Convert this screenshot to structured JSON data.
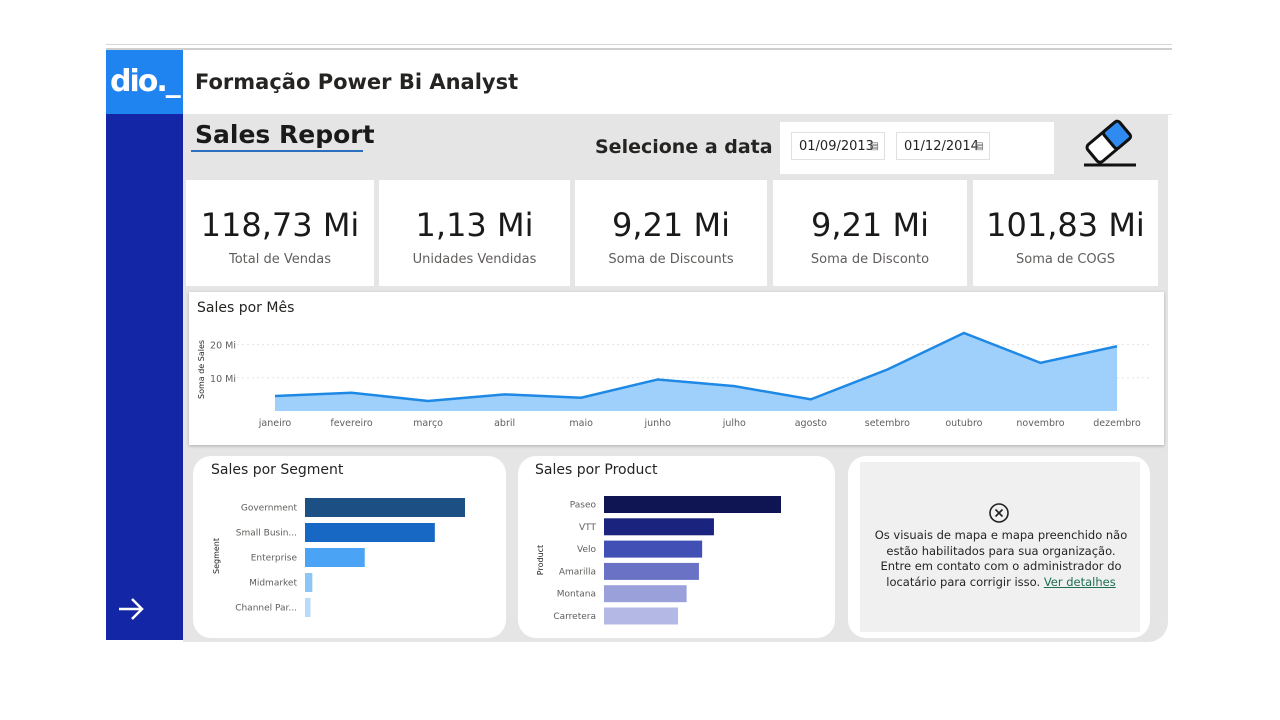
{
  "app": {
    "logo_text": "dio._",
    "title": "Formação Power Bi Analyst"
  },
  "report": {
    "title": "Sales Report",
    "date_label": "Selecione a data",
    "date_start": "01/09/2013",
    "date_end": "01/12/2014"
  },
  "kpis": [
    {
      "value": "118,73 Mi",
      "label": "Total de Vendas"
    },
    {
      "value": "1,13 Mi",
      "label": "Unidades Vendidas"
    },
    {
      "value": "9,21 Mi",
      "label": "Soma de Discounts"
    },
    {
      "value": "9,21 Mi",
      "label": "Soma de Disconto"
    },
    {
      "value": "101,83 Mi",
      "label": "Soma de COGS"
    }
  ],
  "chart_data": [
    {
      "type": "area",
      "title": "Sales por Mês",
      "ylabel": "Soma de Sales",
      "xlabel": "",
      "yticks": [
        "10 Mi",
        "20 Mi"
      ],
      "ylim": [
        0,
        25
      ],
      "grid": true,
      "categories": [
        "janeiro",
        "fevereiro",
        "março",
        "abril",
        "maio",
        "junho",
        "julho",
        "agosto",
        "setembro",
        "outubro",
        "novembro",
        "dezembro"
      ],
      "values": [
        4.5,
        5.5,
        3.0,
        5.0,
        4.0,
        9.5,
        7.5,
        3.5,
        12.5,
        23.5,
        14.5,
        19.5
      ]
    },
    {
      "type": "bar",
      "orientation": "horizontal",
      "title": "Sales por Segment",
      "ylabel": "Segment",
      "categories": [
        "Government",
        "Small Busin...",
        "Enterprise",
        "Midmarket",
        "Channel Par..."
      ],
      "values": [
        52.5,
        42.6,
        19.6,
        2.4,
        1.8
      ],
      "colors": [
        "#1c4f84",
        "#1668c4",
        "#4aa3f5",
        "#8cc6f7",
        "#b7dbfa"
      ]
    },
    {
      "type": "bar",
      "orientation": "horizontal",
      "title": "Sales por Product",
      "ylabel": "Product",
      "categories": [
        "Paseo",
        "VTT",
        "Velo",
        "Amarilla",
        "Montana",
        "Carretera"
      ],
      "values": [
        33.0,
        20.5,
        18.3,
        17.7,
        15.4,
        13.8
      ],
      "colors": [
        "#0f1553",
        "#1a237e",
        "#4050b5",
        "#6a72c6",
        "#9aa1da",
        "#b3b8e4"
      ]
    }
  ],
  "map_visual": {
    "message": "Os visuais de mapa e mapa preenchido não estão habilitados para sua organização. Entre em contato com o administrador do locatário para corrigir isso.",
    "link": "Ver detalhes",
    "icon": "close-circle-icon"
  },
  "colors": {
    "sidebar": "#1327a6",
    "logo_bg": "#1f84f0",
    "area_fill": "#9fd0fb",
    "area_line": "#1e88e5"
  },
  "icons": {
    "calendar": "calendar-icon",
    "eraser": "eraser-icon",
    "next": "arrow-right-icon"
  }
}
